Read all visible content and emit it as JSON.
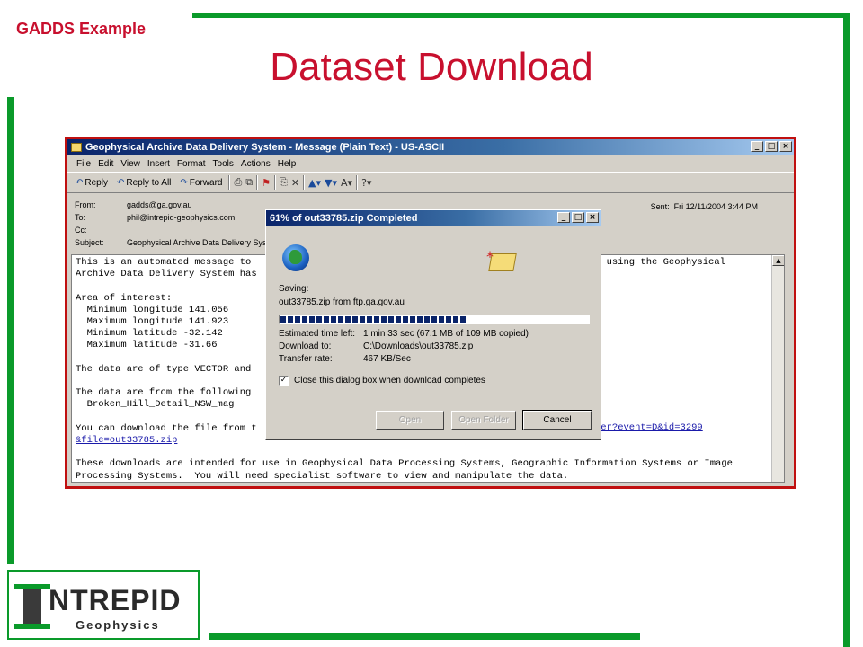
{
  "slide": {
    "tag": "GADDS Example",
    "title": "Dataset Download",
    "logo": {
      "letter": "I",
      "main": "NTREPID",
      "sub": "Geophysics"
    }
  },
  "colors": {
    "accent_red": "#c8102e",
    "frame_green": "#0a9a2a",
    "title_blue": "#0a246a"
  },
  "email_window": {
    "title": "Geophysical Archive Data Delivery System - Message (Plain Text)  - US-ASCII",
    "menu": [
      "File",
      "Edit",
      "View",
      "Insert",
      "Format",
      "Tools",
      "Actions",
      "Help"
    ],
    "toolbar": {
      "reply": "Reply",
      "reply_all": "Reply to All",
      "forward": "Forward"
    },
    "headers": {
      "from_label": "From:",
      "from": "gadds@ga.gov.au",
      "to_label": "To:",
      "to": "phil@intrepid-geophysics.com",
      "cc_label": "Cc:",
      "cc": "",
      "subject_label": "Subject:",
      "subject": "Geophysical Archive Data Delivery System",
      "sent_label": "Sent:",
      "sent": "Fri 12/11/2004 3:44 PM"
    },
    "body_lines": [
      "This is an automated message to",
      "Archive Data Delivery System has",
      "",
      "Area of interest:",
      "  Minimum longitude 141.056",
      "  Maximum longitude 141.923",
      "  Minimum latitude -32.142",
      "  Maximum latitude -31.66",
      "",
      "The data are of type VECTOR and",
      "",
      "The data are from the following",
      "  Broken_Hill_Detail_NSW_mag",
      "",
      "You can download the file from t"
    ],
    "body_right_1": "s using the Geophysical",
    "link_tail": "ler?event=D&id=3299",
    "link_line2": "&file=out33785.zip",
    "body_tail": [
      "",
      "These downloads are intended for use in Geophysical Data Processing Systems, Geographic Information Systems or Image",
      "Processing Systems.  You will need specialist software to view and manipulate the data."
    ]
  },
  "download_dialog": {
    "title": "61% of out33785.zip Completed",
    "saving_label": "Saving:",
    "saving_value": "out33785.zip from ftp.ga.gov.au",
    "progress_fraction": 0.61,
    "time_left_label": "Estimated time left:",
    "time_left_value": "1 min 33 sec (67.1 MB of 109 MB copied)",
    "download_to_label": "Download to:",
    "download_to_value": "C:\\Downloads\\out33785.zip",
    "rate_label": "Transfer rate:",
    "rate_value": "467 KB/Sec",
    "close_checkbox_label": "Close this dialog box when download completes",
    "close_checked": true,
    "open_button": "Open",
    "open_folder_button": "Open Folder",
    "cancel_button": "Cancel"
  }
}
